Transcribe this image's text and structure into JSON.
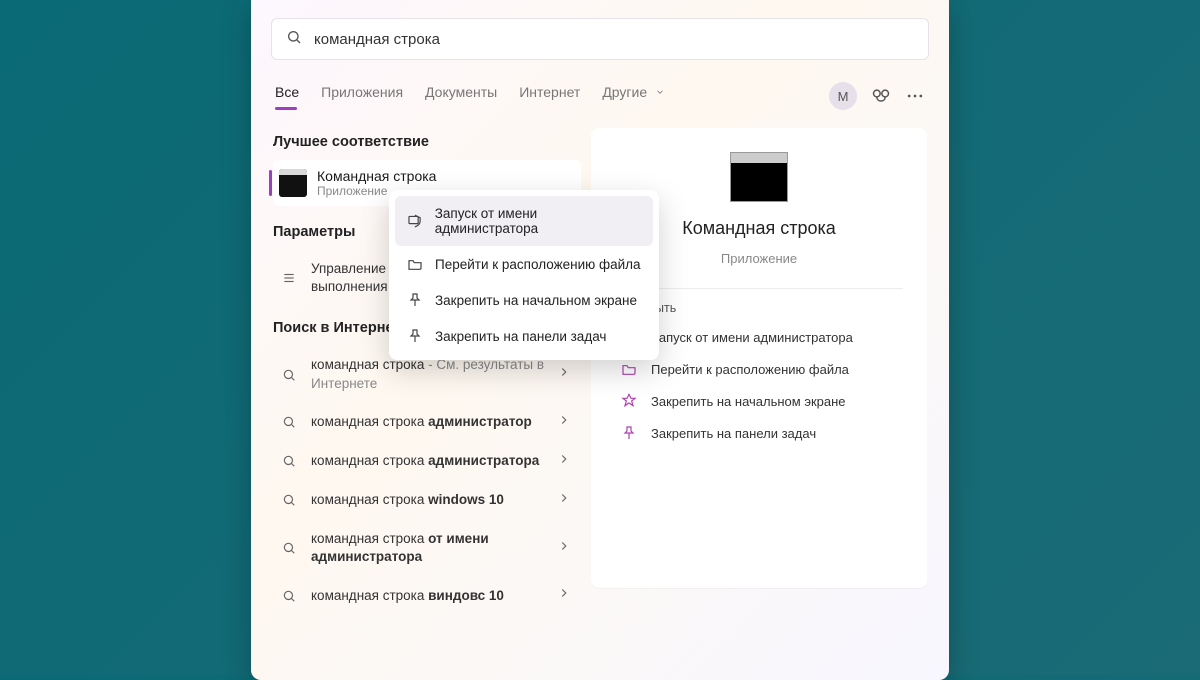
{
  "search": {
    "value": "командная строка"
  },
  "tabs": {
    "items": [
      "Все",
      "Приложения",
      "Документы",
      "Интернет",
      "Другие"
    ],
    "active_index": 0
  },
  "avatar_letter": "M",
  "sections": {
    "best_match": "Лучшее соответствие",
    "settings": "Параметры",
    "web": "Поиск в Интернете"
  },
  "best_match": {
    "title": "Командная строка",
    "subtitle": "Приложение"
  },
  "settings_item": {
    "line1": "Управление п",
    "line2": "выполнения п"
  },
  "web_results": [
    {
      "prefix": "командная строка",
      "bold": "",
      "suffix": " - См. результаты в Интернете"
    },
    {
      "prefix": "командная строка ",
      "bold": "администратор",
      "suffix": ""
    },
    {
      "prefix": "командная строка ",
      "bold": "администратора",
      "suffix": ""
    },
    {
      "prefix": "командная строка ",
      "bold": "windows 10",
      "suffix": ""
    },
    {
      "prefix": "командная строка ",
      "bold": "от имени администратора",
      "suffix": ""
    },
    {
      "prefix": "командная строка ",
      "bold": "виндовс 10",
      "suffix": ""
    }
  ],
  "preview": {
    "title": "Командная строка",
    "subtitle": "Приложение",
    "peek_action": "ыть",
    "actions": [
      "Запуск от имени администратора",
      "Перейти к расположению файла",
      "Закрепить на начальном экране",
      "Закрепить на панели задач"
    ]
  },
  "context_menu": {
    "items": [
      "Запуск от имени администратора",
      "Перейти к расположению файла",
      "Закрепить на начальном экране",
      "Закрепить на панели задач"
    ],
    "hover_index": 0
  }
}
